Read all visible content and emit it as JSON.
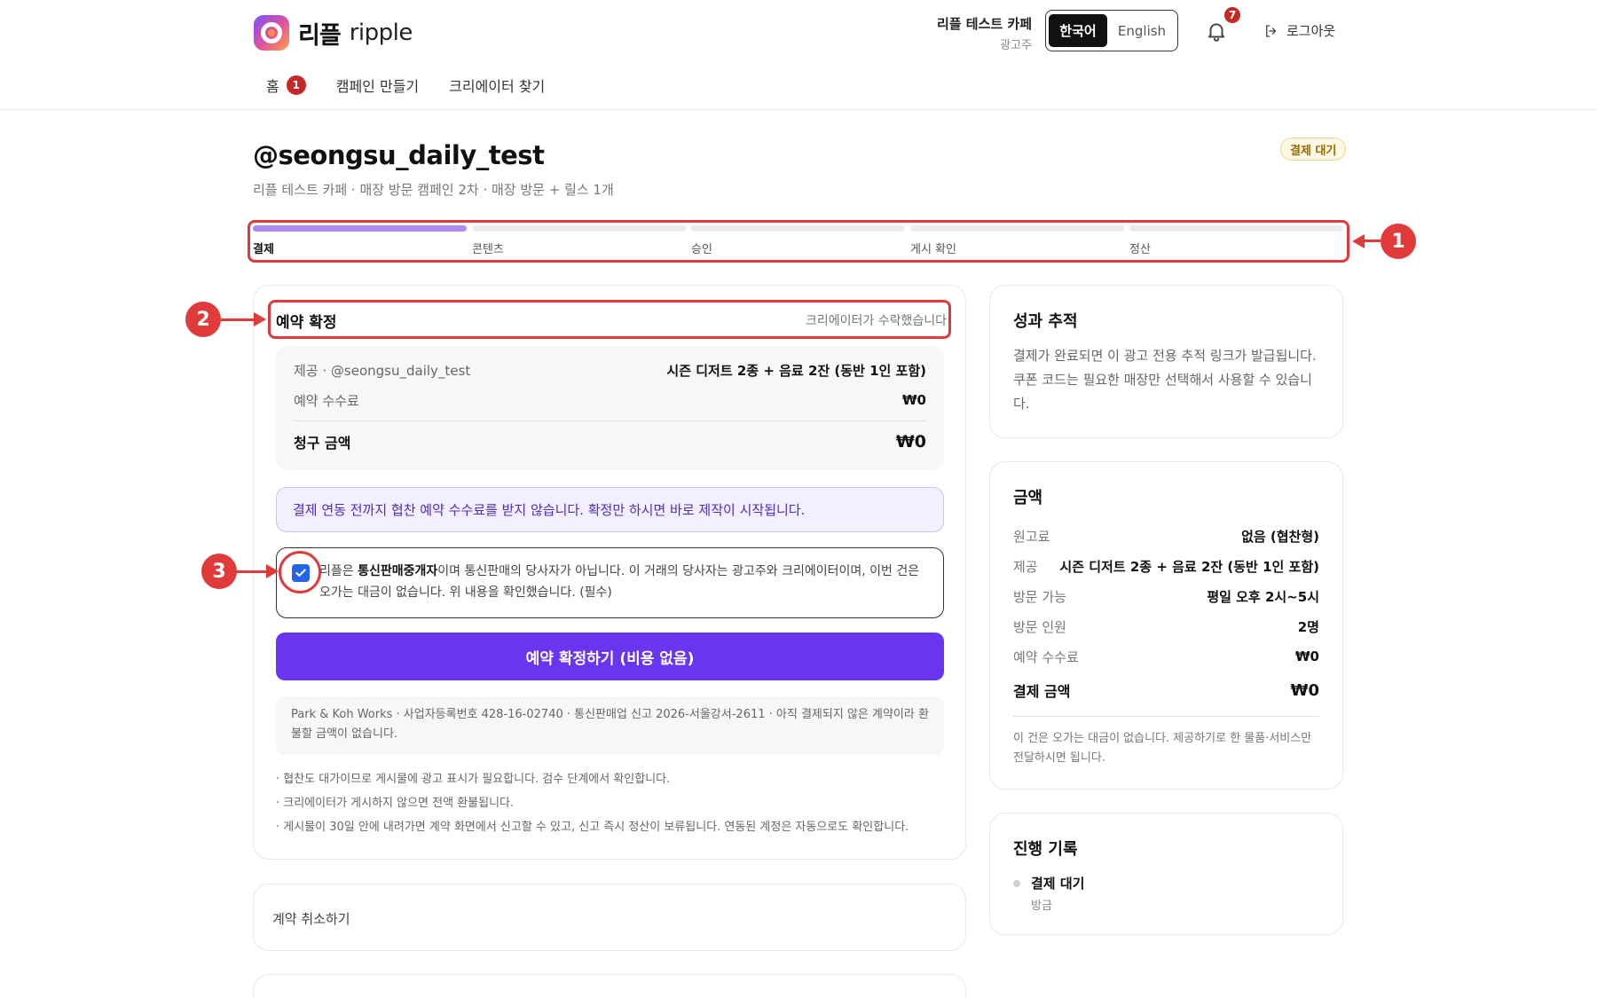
{
  "colors": {
    "accent": "#6a35f0",
    "progress_active": "#a98bf2",
    "notice_bg": "#f3efff",
    "badge_red": "#c62828",
    "annotation_red": "#e03a3a",
    "status_badge": "#9a6a00"
  },
  "header": {
    "logo_ko": "리플",
    "logo_en": "ripple",
    "account_name": "리플 테스트 카페",
    "account_role": "광고주",
    "lang_ko": "한국어",
    "lang_en": "English",
    "notification_count": "7",
    "logout_label": "로그아웃"
  },
  "nav": {
    "home": "홈",
    "home_badge": "1",
    "create_campaign": "캠페인 만들기",
    "find_creator": "크리에이터 찾기"
  },
  "page": {
    "title": "@seongsu_daily_test",
    "subtitle": "리플 테스트 카페 · 매장 방문 캠페인 2차 · 매장 방문 + 릴스 1개",
    "status_badge": "결제 대기"
  },
  "steps": [
    {
      "label": "결제",
      "active": true
    },
    {
      "label": "콘텐츠",
      "active": false
    },
    {
      "label": "승인",
      "active": false
    },
    {
      "label": "게시 확인",
      "active": false
    },
    {
      "label": "정산",
      "active": false
    }
  ],
  "reservation": {
    "title": "예약 확정",
    "note": "크리에이터가 수락했습니다",
    "offer_label": "제공 · @seongsu_daily_test",
    "offer_value": "시즌 디저트 2종 + 음료 2잔 (동반 1인 포함)",
    "fee_label": "예약 수수료",
    "fee_value": "₩0",
    "total_label": "청구 금액",
    "total_value": "₩0",
    "notice": "결제 연동 전까지 협찬 예약 수수료를 받지 않습니다. 확정만 하시면 바로 제작이 시작됩니다.",
    "consent_pre": "리플은 ",
    "consent_bold": "통신판매중개자",
    "consent_post": "이며 통신판매의 당사자가 아닙니다. 이 거래의 당사자는 광고주와 크리에이터이며, 이번 건은 오가는 대금이 없습니다. 위 내용을 확인했습니다. (필수)",
    "cta": "예약 확정하기 (비용 없음)",
    "biz_info": "Park & Koh Works · 사업자등록번호 428-16-02740 · 통신판매업 신고 2026-서울강서-2611 · 아직 결제되지 않은 계약이라 환불할 금액이 없습니다.",
    "bullets": [
      "· 협찬도 대가이므로 게시물에 광고 표시가 필요합니다. 검수 단계에서 확인합니다.",
      "· 크리에이터가 게시하지 않으면 전액 환불됩니다.",
      "· 게시물이 30일 안에 내려가면 계약 화면에서 신고할 수 있고, 신고 즉시 정산이 보류됩니다. 연동된 계정은 자동으로도 확인합니다."
    ],
    "cancel_label": "계약 취소하기"
  },
  "tracking": {
    "title": "성과 추적",
    "text": "결제가 완료되면 이 광고 전용 추적 링크가 발급됩니다. 쿠폰 코드는 필요한 매장만 선택해서 사용할 수 있습니다."
  },
  "amount": {
    "title": "금액",
    "rows": [
      {
        "label": "원고료",
        "value": "없음 (협찬형)"
      },
      {
        "label": "제공",
        "value": "시즌 디저트 2종 + 음료 2잔 (동반 1인 포함)"
      },
      {
        "label": "방문 가능",
        "value": "평일 오후 2시~5시"
      },
      {
        "label": "방문 인원",
        "value": "2명"
      },
      {
        "label": "예약 수수료",
        "value": "₩0"
      }
    ],
    "total_label": "결제 금액",
    "total_value": "₩0",
    "footnote": "이 건은 오가는 대금이 없습니다. 제공하기로 한 물품·서비스만 전달하시면 됩니다."
  },
  "history": {
    "title": "진행 기록",
    "item_title": "결제 대기",
    "item_time": "방금"
  },
  "annotations": [
    "1",
    "2",
    "3"
  ]
}
